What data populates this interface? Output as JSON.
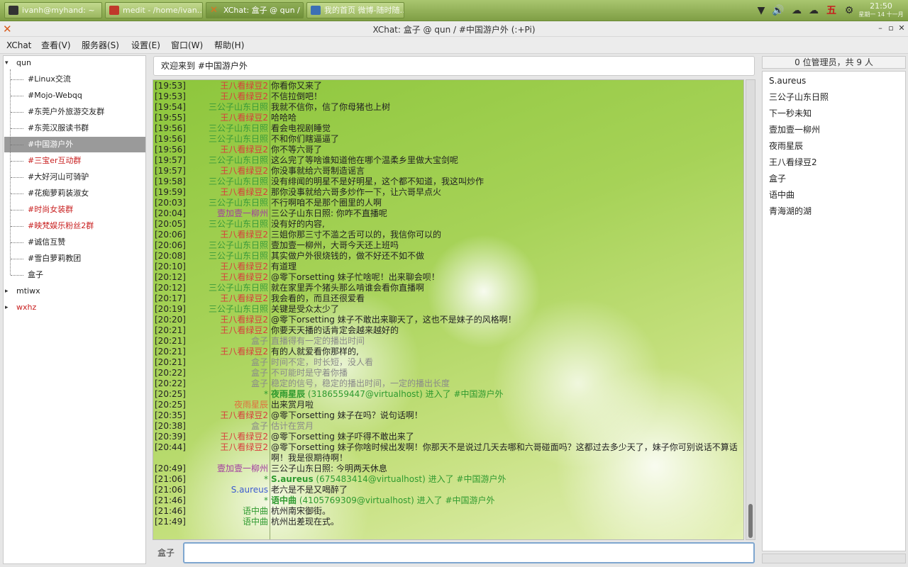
{
  "taskbar": {
    "tasks": [
      {
        "label": "ivanh@myhand: ~"
      },
      {
        "label": "medit - /home/ivan…"
      },
      {
        "label": "XChat: 盒子 @ qun / …"
      },
      {
        "label": "我的首页 微博-随时随…"
      }
    ],
    "tray": {
      "ime": "五"
    },
    "clock": {
      "time": "21:50",
      "date": "星期一 14 十一月"
    }
  },
  "window": {
    "title": "XChat: 盒子 @ qun / #中国游户外  (:+Pi)"
  },
  "menu": [
    "XChat",
    "查看(V)",
    "服务器(S)",
    "设置(E)",
    "窗口(W)",
    "帮助(H)"
  ],
  "tree": {
    "servers": [
      {
        "name": "qun",
        "expander": "▾"
      },
      {
        "name": "mtiwx",
        "expander": "▸"
      },
      {
        "name": "wxhz",
        "expander": "▸"
      }
    ],
    "channels": [
      "#Linux交流",
      "#Mojo-Webqq",
      "#东莞户外旅游交友群",
      "#东莞汉服读书群",
      "#中国游户外",
      "#三宝er互动群",
      "#大好河山可骑驴",
      "#花痴萝莉装淑女",
      "#时尚女装群",
      "#映梵娱乐粉丝2群",
      "#诚信互赞",
      "#雪白萝莉教团",
      "盒子"
    ]
  },
  "topic": "欢迎来到 #中国游户外",
  "colors": {
    "wang": "#d83c3c",
    "sangongzi": "#3a9a3a",
    "yijia": "#a23ca0",
    "hezi": "#8a8a8a",
    "yeyu": "#e07040",
    "join": "#2f9a2f",
    "saureus": "#3c5ad0",
    "yuzhong": "#2f9a2f",
    "channel_red": "#c81e1e",
    "channel_normal": "#222222"
  },
  "chat": [
    {
      "time": "[19:53]",
      "nick": "王八看绿豆2",
      "c": "wang",
      "msg": "你看你又来了"
    },
    {
      "time": "[19:53]",
      "nick": "王八看绿豆2",
      "c": "wang",
      "msg": "不信拉倒吧！"
    },
    {
      "time": "[19:54]",
      "nick": "三公子山东日照",
      "c": "sangongzi",
      "msg": "我就不信你，信了你母猪也上树"
    },
    {
      "time": "[19:55]",
      "nick": "王八看绿豆2",
      "c": "wang",
      "msg": "哈哈哈"
    },
    {
      "time": "[19:56]",
      "nick": "三公子山东日照",
      "c": "sangongzi",
      "msg": "看会电视剧睡觉"
    },
    {
      "time": "[19:56]",
      "nick": "三公子山东日照",
      "c": "sangongzi",
      "msg": "不和你们瞎逼逼了"
    },
    {
      "time": "[19:56]",
      "nick": "王八看绿豆2",
      "c": "wang",
      "msg": "你不等六哥了"
    },
    {
      "time": "[19:57]",
      "nick": "三公子山东日照",
      "c": "sangongzi",
      "msg": "这么完了等啥谁知道他在哪个温柔乡里做大宝剑呢"
    },
    {
      "time": "[19:57]",
      "nick": "王八看绿豆2",
      "c": "wang",
      "msg": "你没事就给六哥制造谣言"
    },
    {
      "time": "[19:58]",
      "nick": "三公子山东日照",
      "c": "sangongzi",
      "msg": "没有绯闻的明星不是好明星，这个都不知道，我这叫炒作"
    },
    {
      "time": "[19:59]",
      "nick": "王八看绿豆2",
      "c": "wang",
      "msg": "那你没事就给六哥多炒作一下，让六哥早点火"
    },
    {
      "time": "[20:03]",
      "nick": "三公子山东日照",
      "c": "sangongzi",
      "msg": "不行啊咱不是那个圈里的人啊"
    },
    {
      "time": "[20:04]",
      "nick": "壹加壹一柳州",
      "c": "yijia",
      "msg": "三公子山东日照: 你咋不直播呢"
    },
    {
      "time": "[20:05]",
      "nick": "三公子山东日照",
      "c": "sangongzi",
      "msg": "没有好的内容,"
    },
    {
      "time": "[20:06]",
      "nick": "王八看绿豆2",
      "c": "wang",
      "msg": "三姐你那三寸不滥之舌可以的，我信你可以的"
    },
    {
      "time": "[20:06]",
      "nick": "三公子山东日照",
      "c": "sangongzi",
      "msg": "壹加壹一柳州，大哥今天还上班吗"
    },
    {
      "time": "[20:08]",
      "nick": "三公子山东日照",
      "c": "sangongzi",
      "msg": "其实做户外很烧钱的，做不好还不如不做"
    },
    {
      "time": "[20:10]",
      "nick": "王八看绿豆2",
      "c": "wang",
      "msg": "有道理"
    },
    {
      "time": "[20:12]",
      "nick": "王八看绿豆2",
      "c": "wang",
      "msg": "@零下orsetting 妹子忙啥呢！出来聊会呗！"
    },
    {
      "time": "[20:12]",
      "nick": "三公子山东日照",
      "c": "sangongzi",
      "msg": "就在家里弄个猪头那么啃谁会看你直播啊"
    },
    {
      "time": "[20:17]",
      "nick": "王八看绿豆2",
      "c": "wang",
      "msg": "我会看的，而且还很爱看"
    },
    {
      "time": "[20:19]",
      "nick": "三公子山东日照",
      "c": "sangongzi",
      "msg": "关键是受众太少了"
    },
    {
      "time": "[20:20]",
      "nick": "王八看绿豆2",
      "c": "wang",
      "msg": "@零下orsetting 妹子不敢出来聊天了，这也不是妹子的风格啊！"
    },
    {
      "time": "[20:21]",
      "nick": "王八看绿豆2",
      "c": "wang",
      "msg": "你要天天播的话肯定会越来越好的"
    },
    {
      "time": "[20:21]",
      "nick": "盒子",
      "c": "hezi",
      "msg": "直播得有一定的播出时间",
      "gray": true
    },
    {
      "time": "[20:21]",
      "nick": "王八看绿豆2",
      "c": "wang",
      "msg": "有的人就爱看你那样的,"
    },
    {
      "time": "[20:21]",
      "nick": "盒子",
      "c": "hezi",
      "msg": "时间不定，时长短，没人看",
      "gray": true
    },
    {
      "time": "[20:22]",
      "nick": "盒子",
      "c": "hezi",
      "msg": "不可能时是守着你播",
      "gray": true
    },
    {
      "time": "[20:22]",
      "nick": "盒子",
      "c": "hezi",
      "msg": "稳定的信号，稳定的播出时间，一定的播出长度",
      "gray": true
    },
    {
      "time": "[20:25]",
      "nick": "*",
      "c": "join",
      "join": true,
      "who": "夜雨星辰",
      "msg": " (3186559447@virtualhost) 进入了 #中国游户外"
    },
    {
      "time": "[20:25]",
      "nick": "夜雨星辰",
      "c": "yeyu",
      "msg": "出来赏月啦"
    },
    {
      "time": "[20:35]",
      "nick": "王八看绿豆2",
      "c": "wang",
      "msg": "@零下orsetting 妹子在吗？说句话啊！"
    },
    {
      "time": "[20:38]",
      "nick": "盒子",
      "c": "hezi",
      "msg": "估计在赏月",
      "gray": true
    },
    {
      "time": "[20:39]",
      "nick": "王八看绿豆2",
      "c": "wang",
      "msg": "@零下orsetting 妹子吓得不敢出来了"
    },
    {
      "time": "[20:44]",
      "nick": "王八看绿豆2",
      "c": "wang",
      "tall": true,
      "msg": "@零下orsetting 妹子你啥时候出发啊！你那天不是说过几天去哪和六哥碰面吗？这都过去多少天了，妹子你可别说话不算话啊！我是很期待啊！"
    },
    {
      "time": "[20:49]",
      "nick": "壹加壹一柳州",
      "c": "yijia",
      "msg": "三公子山东日照: 今明两天休息"
    },
    {
      "time": "[21:06]",
      "nick": "*",
      "c": "join",
      "join": true,
      "who": "S.aureus",
      "msg": " (675483414@virtualhost) 进入了 #中国游户外"
    },
    {
      "time": "[21:06]",
      "nick": "S.aureus",
      "c": "saureus",
      "msg": "老六是不是又喝醉了"
    },
    {
      "time": "[21:46]",
      "nick": "*",
      "c": "join",
      "join": true,
      "who": "语中曲",
      "msg": " (4105769309@virtualhost) 进入了 #中国游户外"
    },
    {
      "time": "[21:46]",
      "nick": "语中曲",
      "c": "yuzhong",
      "msg": "杭州南宋御街。"
    },
    {
      "time": "[21:49]",
      "nick": "语中曲",
      "c": "yuzhong",
      "msg": "杭州出差现在式。"
    }
  ],
  "input": {
    "nick": "盒子",
    "value": ""
  },
  "users": {
    "count": "0 位管理员，共 9 人",
    "list": [
      "S.aureus",
      "三公子山东日照",
      "下一秒未知",
      "壹加壹一柳州",
      "夜雨星辰",
      "王八看绿豆2",
      "盒子",
      "语中曲",
      "青海湖的湖"
    ]
  }
}
